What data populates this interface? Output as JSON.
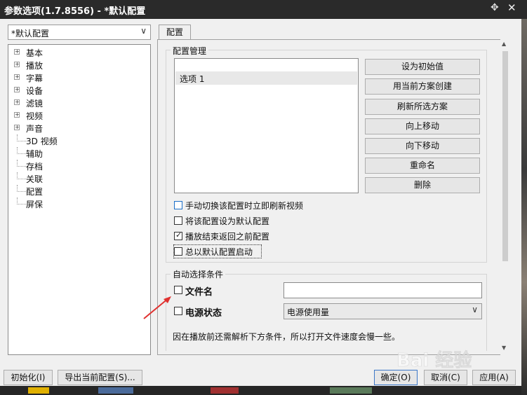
{
  "window": {
    "title": "参数选项(1.7.8556) - *默认配置",
    "pin_icon": "pin-icon",
    "close_icon": "close-icon"
  },
  "profile_select": {
    "value": "*默认配置"
  },
  "tree": {
    "items": [
      {
        "label": "基本",
        "expandable": true
      },
      {
        "label": "播放",
        "expandable": true
      },
      {
        "label": "字幕",
        "expandable": true
      },
      {
        "label": "设备",
        "expandable": true
      },
      {
        "label": "滤镜",
        "expandable": true
      },
      {
        "label": "视频",
        "expandable": true
      },
      {
        "label": "声音",
        "expandable": true
      },
      {
        "label": "3D 视频",
        "expandable": false
      },
      {
        "label": "辅助",
        "expandable": false
      },
      {
        "label": "存档",
        "expandable": false
      },
      {
        "label": "关联",
        "expandable": false
      },
      {
        "label": "配置",
        "expandable": false
      },
      {
        "label": "屏保",
        "expandable": false
      }
    ]
  },
  "tabs": [
    {
      "label": "配置",
      "active": true
    }
  ],
  "config_management": {
    "title": "配置管理",
    "list_items": [
      "选项 1"
    ],
    "buttons": {
      "set_initial": "设为初始值",
      "create_from_current": "用当前方案创建",
      "refresh_selected": "刷新所选方案",
      "move_up": "向上移动",
      "move_down": "向下移动",
      "rename": "重命名",
      "delete": "删除"
    },
    "checkboxes": [
      {
        "label": "手动切换该配置时立即刷新视频",
        "checked": false
      },
      {
        "label": "将该配置设为默认配置",
        "checked": false
      },
      {
        "label": "播放结束返回之前配置",
        "checked": true
      },
      {
        "label": "总以默认配置启动",
        "checked": false
      }
    ]
  },
  "auto_select": {
    "title": "自动选择条件",
    "filename": {
      "label": "文件名",
      "checked": false,
      "value": ""
    },
    "power": {
      "label": "电源状态",
      "checked": false,
      "selected": "电源使用量"
    },
    "note": "因在播放前还需解析下方条件，所以打开文件速度会慢一些。"
  },
  "footer": {
    "init": "初始化(I)",
    "export": "导出当前配置(S)...",
    "ok": "确定(O)",
    "cancel": "取消(C)",
    "apply": "应用(A)"
  },
  "watermark": {
    "text": "Bai 经验"
  },
  "colors": {
    "titlebar": "#2a2a2a",
    "dialog_bg": "#f0f0f0",
    "annotation_arrow": "#e0312f",
    "focus_checkbox": "#1a6ec8"
  }
}
